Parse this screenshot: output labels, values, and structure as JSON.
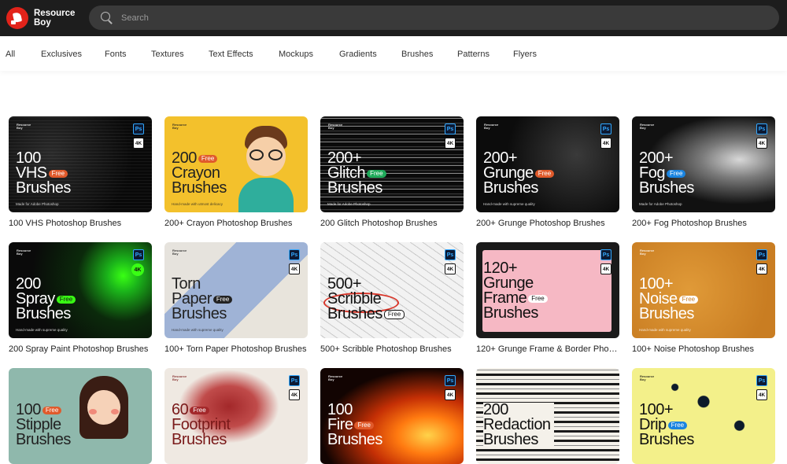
{
  "header": {
    "logo_line1": "Resource",
    "logo_line2": "Boy",
    "search_placeholder": "Search"
  },
  "nav": [
    {
      "label": "All"
    },
    {
      "label": "Exclusives"
    },
    {
      "label": "Fonts"
    },
    {
      "label": "Textures"
    },
    {
      "label": "Text Effects"
    },
    {
      "label": "Mockups"
    },
    {
      "label": "Gradients"
    },
    {
      "label": "Brushes"
    },
    {
      "label": "Patterns"
    },
    {
      "label": "Flyers"
    }
  ],
  "cards": [
    {
      "caption": "100 VHS Photoshop Brushes",
      "l1": "100",
      "l2": "VHS",
      "l3": "Brushes",
      "tagline": "Made for Adobe Photoshop"
    },
    {
      "caption": "200+ Crayon Photoshop Brushes",
      "l1": "200",
      "l2": "Crayon",
      "l3": "Brushes",
      "tagline": "Hand-made with utmost delicacy"
    },
    {
      "caption": "200 Glitch Photoshop Brushes",
      "l1": "200+",
      "l2": "Glitch",
      "l3": "Brushes",
      "tagline": "Made for Adobe Photoshop"
    },
    {
      "caption": "200+ Grunge Photoshop Brushes",
      "l1": "200+",
      "l2": "Grunge",
      "l3": "Brushes",
      "tagline": "Hand-made with supreme quality"
    },
    {
      "caption": "200+ Fog Photoshop Brushes",
      "l1": "200+",
      "l2": "Fog",
      "l3": "Brushes",
      "tagline": "Made for Adobe Photoshop"
    },
    {
      "caption": "200 Spray Paint Photoshop Brushes",
      "l1": "200",
      "l2": "Spray",
      "l3": "Brushes",
      "tagline": "Hand-made with supreme quality"
    },
    {
      "caption": "100+ Torn Paper Photoshop Brushes",
      "l1": "Torn",
      "l2": "Paper",
      "l3": "Brushes",
      "tagline": "Hand-made with supreme quality"
    },
    {
      "caption": "500+ Scribble Photoshop Brushes",
      "l1": "500+",
      "l2": "Scribble",
      "l3": "Brushes",
      "tagline": ""
    },
    {
      "caption": "120+ Grunge Frame & Border Photo...",
      "l1": "120+",
      "l2": "Grunge",
      "l3": "Frame",
      "l4": "Brushes",
      "tagline": ""
    },
    {
      "caption": "100+ Noise Photoshop Brushes",
      "l1": "100+",
      "l2": "Noise",
      "l3": "Brushes",
      "tagline": "Hand-made with supreme quality"
    },
    {
      "l1": "100",
      "l2": "Stipple",
      "l3": "Brushes",
      "tagline": ""
    },
    {
      "l1": "60",
      "l2": "Footprint",
      "l3": "Brushes",
      "tagline": ""
    },
    {
      "l1": "100",
      "l2": "Fire",
      "l3": "Brushes",
      "tagline": ""
    },
    {
      "l1": "200",
      "l2": "Redaction",
      "l3": "Brushes",
      "tagline": ""
    },
    {
      "l1": "100+",
      "l2": "Drip",
      "l3": "Brushes",
      "tagline": ""
    }
  ],
  "badges": {
    "ps": "Ps",
    "res": "4K",
    "free": "Free",
    "brand_line1": "Resource",
    "brand_line2": "Boy"
  },
  "colors": {
    "header_bg": "#1d1d1d",
    "search_bg": "#3a3a3a",
    "logo_red": "#e2231a",
    "free_orange": "#e05a2b",
    "free_green": "#1faa5a",
    "free_blue": "#1a84e0"
  }
}
